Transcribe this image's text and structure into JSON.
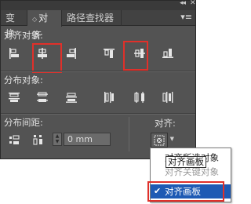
{
  "window": {
    "collapse_glyph": "◂◂",
    "close_glyph": "✕"
  },
  "tabs": [
    {
      "label": "变换",
      "active": false
    },
    {
      "label": "对齐",
      "active": true
    },
    {
      "label": "路径查找器",
      "active": false
    }
  ],
  "tab_active_marker": "◇",
  "panel_menu_glyph": "▾≡",
  "sections": {
    "align_objects": "对齐对象:",
    "distribute_objects": "分布对象:",
    "distribute_spacing": "分布间距:",
    "align_to": "对齐:"
  },
  "spacing_input": {
    "value": "0 mm"
  },
  "spin": {
    "up": "▲",
    "down": "▼"
  },
  "align_to_arrow": "▼",
  "dropdown": {
    "items": [
      {
        "label": "对齐所选对象",
        "state": "normal"
      },
      {
        "label": "对齐关键对象",
        "state": "disabled"
      },
      {
        "label": "对齐画板",
        "state": "selected",
        "check": "✔"
      }
    ]
  },
  "tooltip": "对齐画板",
  "colors": {
    "panel_bg": "#535353",
    "highlight": "#e0302a",
    "selection": "#1e5ab4"
  },
  "icons": [
    "align-left-icon",
    "align-horizontal-center-icon",
    "align-right-icon",
    "align-top-icon",
    "align-vertical-center-icon",
    "align-bottom-icon",
    "distribute-top-icon",
    "distribute-vertical-center-icon",
    "distribute-bottom-icon",
    "distribute-left-icon",
    "distribute-horizontal-center-icon",
    "distribute-right-icon",
    "vertical-distribute-space-icon",
    "horizontal-distribute-space-icon",
    "align-to-artboard-icon"
  ]
}
